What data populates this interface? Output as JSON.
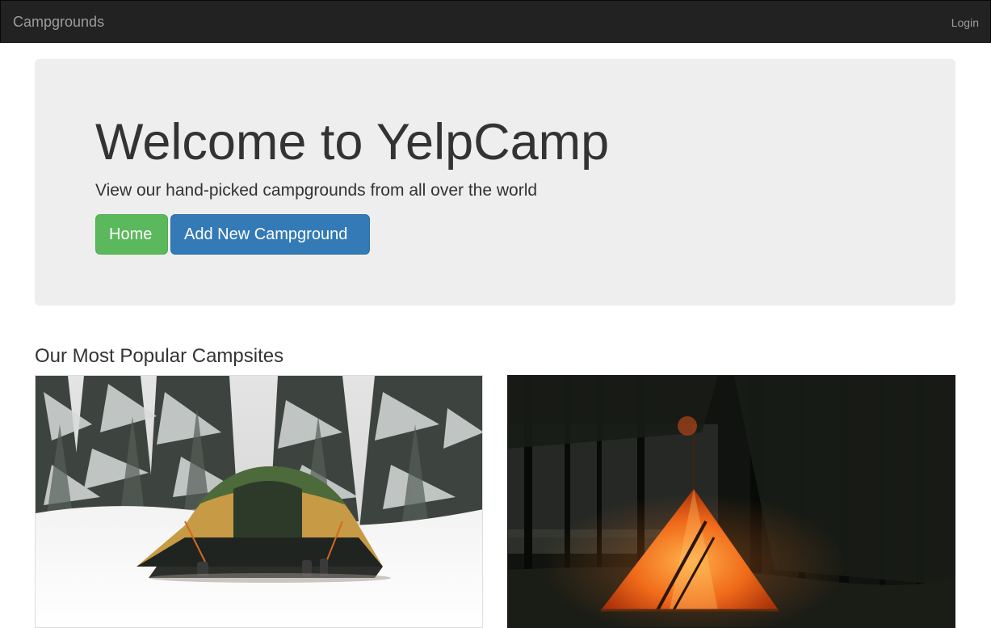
{
  "navbar": {
    "brand": "Campgrounds",
    "login_label": "Login"
  },
  "jumbotron": {
    "title": "Welcome to YelpCamp",
    "subtitle": "View our hand-picked campgrounds from all over the world",
    "home_button": "Home",
    "add_button": "Add New Campground"
  },
  "popular": {
    "heading": "Our Most Popular Campsites",
    "items": [
      {
        "image": "snowy-forest-tent-photo"
      },
      {
        "image": "night-forest-teepee-tent-photo"
      }
    ]
  },
  "colors": {
    "navbar_bg": "#222222",
    "navbar_text": "#9d9d9d",
    "jumbotron_bg": "#eeeeee",
    "home_button": "#5cb85c",
    "add_button": "#337ab7"
  }
}
